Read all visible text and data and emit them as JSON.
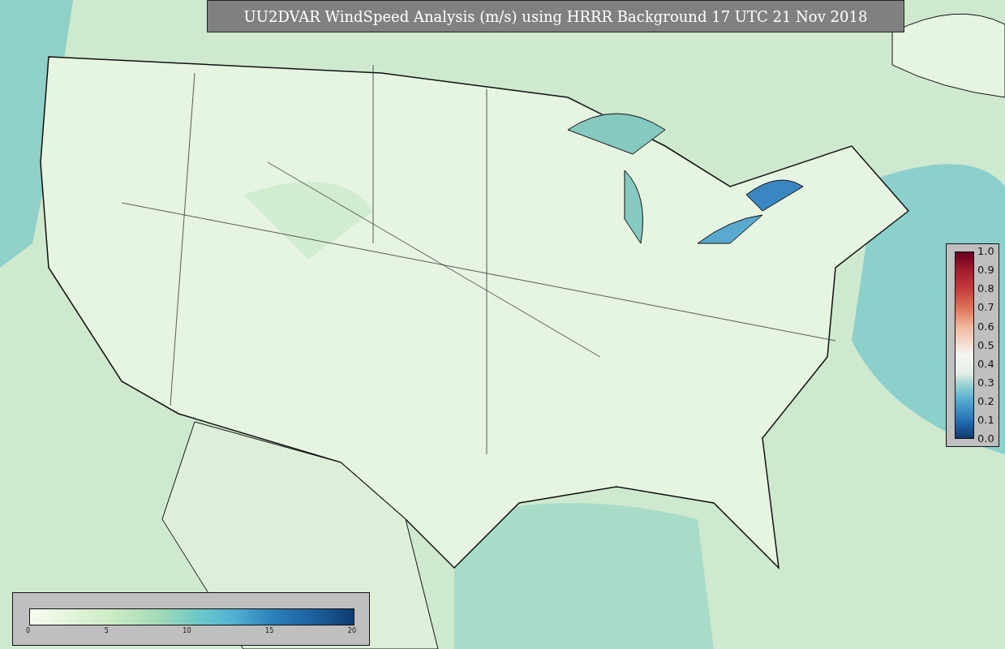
{
  "title": "UU2DVAR WindSpeed Analysis (m/s) using HRRR Background 17 UTC 21 Nov 2018",
  "station_colorbar": {
    "ticks": [
      "1.0",
      "0.9",
      "0.8",
      "0.7",
      "0.6",
      "0.5",
      "0.4",
      "0.3",
      "0.2",
      "0.1",
      "0.0"
    ]
  },
  "wind_colorbar": {
    "ticks": [
      "0",
      "5",
      "10",
      "15",
      "20"
    ]
  }
}
